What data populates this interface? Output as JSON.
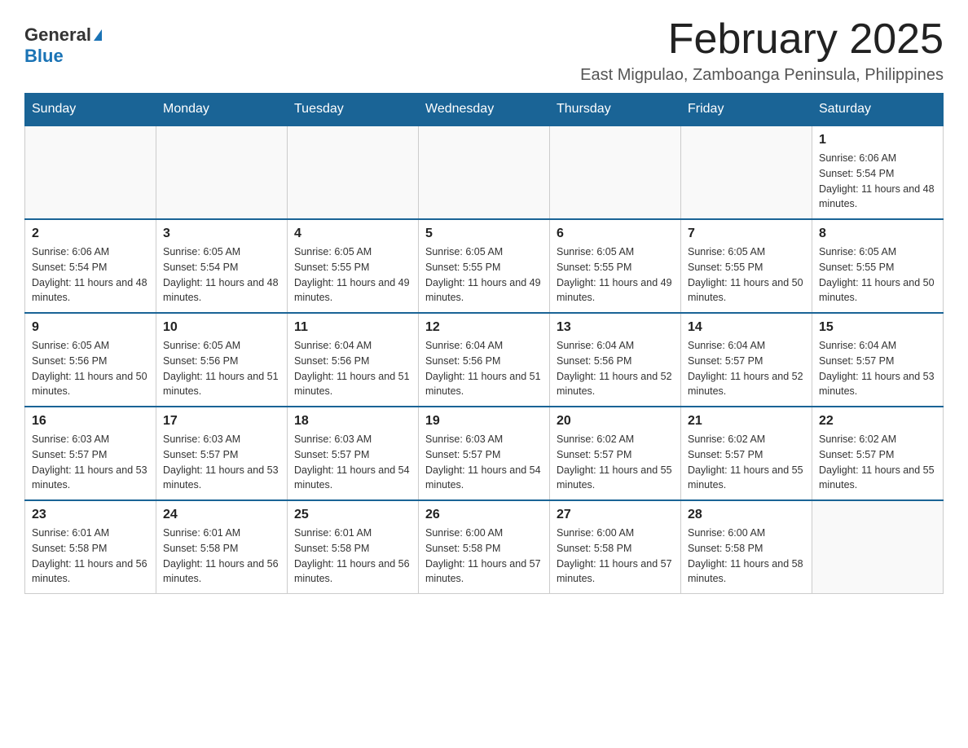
{
  "header": {
    "logo_general": "General",
    "logo_blue": "Blue",
    "month_title": "February 2025",
    "subtitle": "East Migpulao, Zamboanga Peninsula, Philippines"
  },
  "weekdays": [
    "Sunday",
    "Monday",
    "Tuesday",
    "Wednesday",
    "Thursday",
    "Friday",
    "Saturday"
  ],
  "weeks": [
    [
      {
        "day": "",
        "info": ""
      },
      {
        "day": "",
        "info": ""
      },
      {
        "day": "",
        "info": ""
      },
      {
        "day": "",
        "info": ""
      },
      {
        "day": "",
        "info": ""
      },
      {
        "day": "",
        "info": ""
      },
      {
        "day": "1",
        "info": "Sunrise: 6:06 AM\nSunset: 5:54 PM\nDaylight: 11 hours and 48 minutes."
      }
    ],
    [
      {
        "day": "2",
        "info": "Sunrise: 6:06 AM\nSunset: 5:54 PM\nDaylight: 11 hours and 48 minutes."
      },
      {
        "day": "3",
        "info": "Sunrise: 6:05 AM\nSunset: 5:54 PM\nDaylight: 11 hours and 48 minutes."
      },
      {
        "day": "4",
        "info": "Sunrise: 6:05 AM\nSunset: 5:55 PM\nDaylight: 11 hours and 49 minutes."
      },
      {
        "day": "5",
        "info": "Sunrise: 6:05 AM\nSunset: 5:55 PM\nDaylight: 11 hours and 49 minutes."
      },
      {
        "day": "6",
        "info": "Sunrise: 6:05 AM\nSunset: 5:55 PM\nDaylight: 11 hours and 49 minutes."
      },
      {
        "day": "7",
        "info": "Sunrise: 6:05 AM\nSunset: 5:55 PM\nDaylight: 11 hours and 50 minutes."
      },
      {
        "day": "8",
        "info": "Sunrise: 6:05 AM\nSunset: 5:55 PM\nDaylight: 11 hours and 50 minutes."
      }
    ],
    [
      {
        "day": "9",
        "info": "Sunrise: 6:05 AM\nSunset: 5:56 PM\nDaylight: 11 hours and 50 minutes."
      },
      {
        "day": "10",
        "info": "Sunrise: 6:05 AM\nSunset: 5:56 PM\nDaylight: 11 hours and 51 minutes."
      },
      {
        "day": "11",
        "info": "Sunrise: 6:04 AM\nSunset: 5:56 PM\nDaylight: 11 hours and 51 minutes."
      },
      {
        "day": "12",
        "info": "Sunrise: 6:04 AM\nSunset: 5:56 PM\nDaylight: 11 hours and 51 minutes."
      },
      {
        "day": "13",
        "info": "Sunrise: 6:04 AM\nSunset: 5:56 PM\nDaylight: 11 hours and 52 minutes."
      },
      {
        "day": "14",
        "info": "Sunrise: 6:04 AM\nSunset: 5:57 PM\nDaylight: 11 hours and 52 minutes."
      },
      {
        "day": "15",
        "info": "Sunrise: 6:04 AM\nSunset: 5:57 PM\nDaylight: 11 hours and 53 minutes."
      }
    ],
    [
      {
        "day": "16",
        "info": "Sunrise: 6:03 AM\nSunset: 5:57 PM\nDaylight: 11 hours and 53 minutes."
      },
      {
        "day": "17",
        "info": "Sunrise: 6:03 AM\nSunset: 5:57 PM\nDaylight: 11 hours and 53 minutes."
      },
      {
        "day": "18",
        "info": "Sunrise: 6:03 AM\nSunset: 5:57 PM\nDaylight: 11 hours and 54 minutes."
      },
      {
        "day": "19",
        "info": "Sunrise: 6:03 AM\nSunset: 5:57 PM\nDaylight: 11 hours and 54 minutes."
      },
      {
        "day": "20",
        "info": "Sunrise: 6:02 AM\nSunset: 5:57 PM\nDaylight: 11 hours and 55 minutes."
      },
      {
        "day": "21",
        "info": "Sunrise: 6:02 AM\nSunset: 5:57 PM\nDaylight: 11 hours and 55 minutes."
      },
      {
        "day": "22",
        "info": "Sunrise: 6:02 AM\nSunset: 5:57 PM\nDaylight: 11 hours and 55 minutes."
      }
    ],
    [
      {
        "day": "23",
        "info": "Sunrise: 6:01 AM\nSunset: 5:58 PM\nDaylight: 11 hours and 56 minutes."
      },
      {
        "day": "24",
        "info": "Sunrise: 6:01 AM\nSunset: 5:58 PM\nDaylight: 11 hours and 56 minutes."
      },
      {
        "day": "25",
        "info": "Sunrise: 6:01 AM\nSunset: 5:58 PM\nDaylight: 11 hours and 56 minutes."
      },
      {
        "day": "26",
        "info": "Sunrise: 6:00 AM\nSunset: 5:58 PM\nDaylight: 11 hours and 57 minutes."
      },
      {
        "day": "27",
        "info": "Sunrise: 6:00 AM\nSunset: 5:58 PM\nDaylight: 11 hours and 57 minutes."
      },
      {
        "day": "28",
        "info": "Sunrise: 6:00 AM\nSunset: 5:58 PM\nDaylight: 11 hours and 58 minutes."
      },
      {
        "day": "",
        "info": ""
      }
    ]
  ]
}
